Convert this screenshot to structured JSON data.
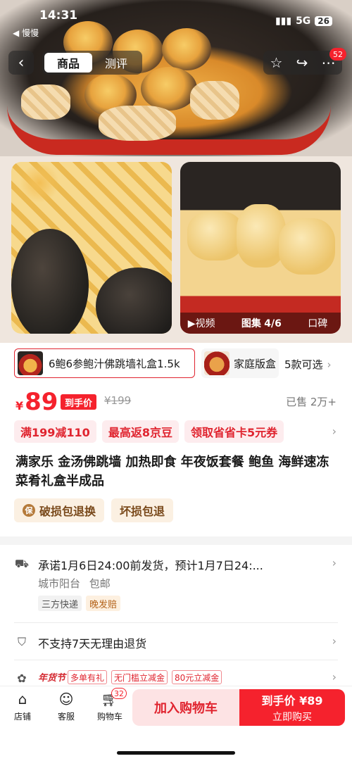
{
  "status_bar": {
    "time": "14:31",
    "back_app": "◀ 慢慢",
    "network": "5G",
    "battery": "26"
  },
  "nav": {
    "back_icon": "chevron-left-icon",
    "tabs": [
      {
        "label": "商品",
        "active": true
      },
      {
        "label": "测评",
        "active": false
      }
    ],
    "actions": [
      "star-icon",
      "share-icon",
      "more-icon"
    ],
    "message_badge": "52"
  },
  "gallery": {
    "video_label": "▶视频",
    "album_label": "图集",
    "album_counter": "4/6",
    "review_label": "口碑"
  },
  "sku": {
    "selected_label": "6鲍6参鲍汁佛跳墙礼盒1.5k",
    "second_label": "家庭版盒",
    "more_label": "5款可选"
  },
  "price": {
    "currency": "¥",
    "value": "89",
    "tag": "到手价",
    "original": "¥199",
    "sold": "已售 2万+"
  },
  "promotions": [
    "满199减110",
    "最高返8京豆",
    "领取省省卡5元券"
  ],
  "title": "满家乐 金汤佛跳墙 加热即食 年夜饭套餐 鲍鱼 海鲜速冻菜肴礼盒半成品",
  "guarantees": [
    {
      "label": "破损包退换",
      "icon": "保"
    },
    {
      "label": "坏损包退",
      "icon": ""
    }
  ],
  "shipping": {
    "line1": "承诺1月6日24:00前发货，预计1月7日24:...",
    "location": "城市阳台",
    "shipping_fee": "包邮",
    "tags": [
      "三方快递",
      "晚发赔"
    ]
  },
  "returns": {
    "text": "不支持7天无理由退货"
  },
  "festival": {
    "logo": "年货节",
    "tags": [
      "多单有礼",
      "无门槛立减金",
      "80元立减金"
    ]
  },
  "bottom_bar": {
    "store_label": "店铺",
    "service_label": "客服",
    "cart_label": "购物车",
    "cart_count": "32",
    "add_to_cart": "加入购物车",
    "buy_line1": "到手价 ¥89",
    "buy_line2": "立即购买"
  },
  "colors": {
    "accent": "#f5222d",
    "promo_bg": "#fdecee",
    "guarantee_bg": "#fbf0e2"
  }
}
